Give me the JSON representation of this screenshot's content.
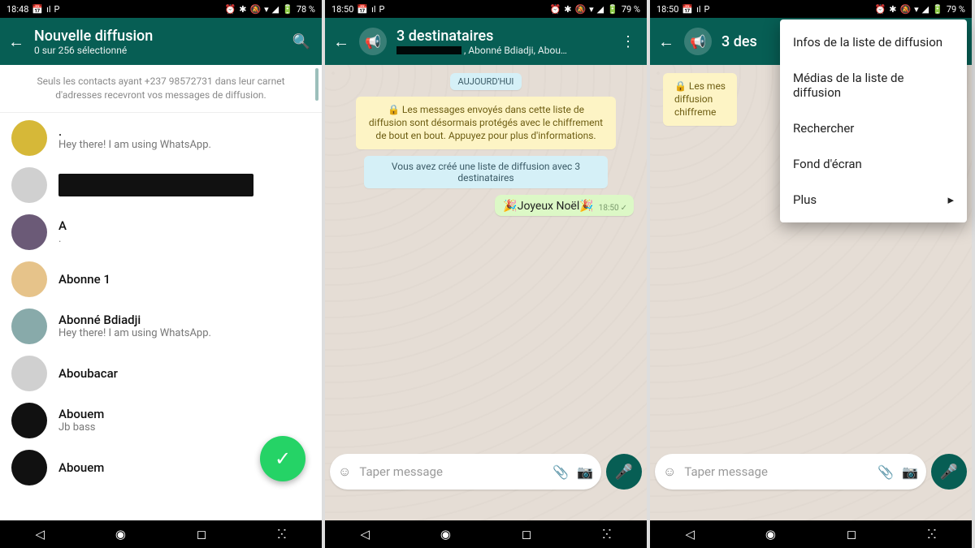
{
  "screens": {
    "s1": {
      "statusbar": {
        "time": "18:48",
        "battery": "78 %"
      },
      "appbar": {
        "title": "Nouvelle diffusion",
        "subtitle": "0 sur 256 sélectionné"
      },
      "notice": "Seuls les contacts ayant +237 98572731 dans leur carnet d'adresses recevront vos messages de diffusion.",
      "contacts": [
        {
          "name": ".",
          "status": "Hey there! I am using WhatsApp."
        },
        {
          "name": "",
          "status": ""
        },
        {
          "name": "A",
          "status": "."
        },
        {
          "name": "Abonne 1",
          "status": ""
        },
        {
          "name": "Abonné Bdiadji",
          "status": "Hey there! I am using WhatsApp."
        },
        {
          "name": "Aboubacar",
          "status": ""
        },
        {
          "name": "Abouem",
          "status": "Jb bass"
        },
        {
          "name": "Abouem",
          "status": ""
        }
      ]
    },
    "s2": {
      "statusbar": {
        "time": "18:50",
        "battery": "79 %"
      },
      "appbar": {
        "title": "3 destinataires",
        "subtitle": ", Abonné Bdiadji, Abou…"
      },
      "chat": {
        "date_chip": "AUJOURD'HUI",
        "enc_notice": "🔒 Les messages envoyés dans cette liste de diffusion sont désormais protégés avec le chiffrement de bout en bout. Appuyez pour plus d'informations.",
        "sys_notice": "Vous avez créé une liste de diffusion avec 3 destinataires",
        "msg_text": "🎉Joyeux Noël🎉",
        "msg_time": "18:50"
      },
      "input_placeholder": "Taper message"
    },
    "s3": {
      "statusbar": {
        "time": "18:50",
        "battery": "79 %"
      },
      "appbar": {
        "title": "3 des"
      },
      "menu": {
        "i1": "Infos de la liste de diffusion",
        "i2": "Médias de la liste de diffusion",
        "i3": "Rechercher",
        "i4": "Fond d'écran",
        "i5": "Plus"
      },
      "input_placeholder": "Taper message"
    }
  }
}
